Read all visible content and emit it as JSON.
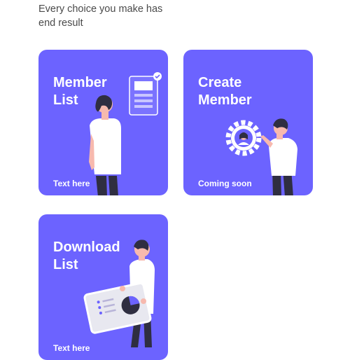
{
  "intro": {
    "text": "Every choice you make has end result"
  },
  "cards": [
    {
      "title_line1": "Member",
      "title_line2": "List",
      "subtitle": "Text here",
      "illustration": "person-with-document-illustration"
    },
    {
      "title_line1": "Create",
      "title_line2": "Member",
      "subtitle": "Coming soon",
      "illustration": "person-with-gear-illustration"
    },
    {
      "title_line1": "Download",
      "title_line2": "List",
      "subtitle": "Text here",
      "illustration": "person-with-chart-board-illustration"
    }
  ],
  "colors": {
    "card_bg": "#6c63ff",
    "skin": "#f7b9ae",
    "hair": "#2f2e41",
    "shirt": "#ffffff"
  }
}
